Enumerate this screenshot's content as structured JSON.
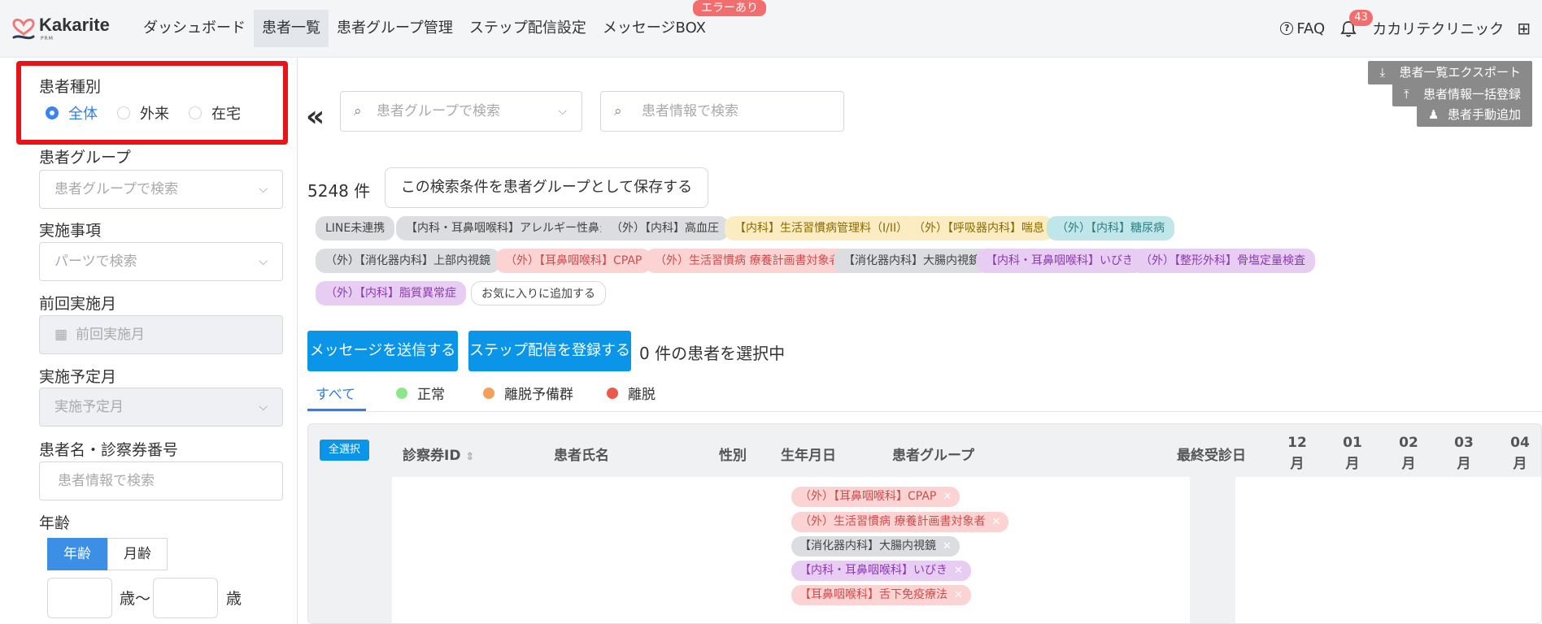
{
  "header": {
    "logo_name": "Kakarite",
    "logo_sub": "PRM",
    "nav": [
      "ダッシュボード",
      "患者一覧",
      "患者グループ管理",
      "ステップ配信設定",
      "メッセージBOX"
    ],
    "error_badge": "エラーあり",
    "faq": "FAQ",
    "notification_count": "43",
    "clinic_name": "カカリテクリニック"
  },
  "sidebar": {
    "patient_type_label": "患者種別",
    "patient_type_options": [
      "全体",
      "外来",
      "在宅"
    ],
    "patient_group_label": "患者グループ",
    "patient_group_placeholder": "患者グループで検索",
    "item_label": "実施事項",
    "item_placeholder": "パーツで検索",
    "last_month_label": "前回実施月",
    "last_month_placeholder": "前回実施月",
    "planned_month_label": "実施予定月",
    "planned_month_placeholder": "実施予定月",
    "name_label": "患者名・診察券番号",
    "name_placeholder": "患者情報で検索",
    "age_label": "年齢",
    "age_toggle": [
      "年齢",
      "月齢"
    ],
    "age_unit_from": "歳〜",
    "age_unit_to": "歳"
  },
  "main": {
    "group_search_placeholder": "患者グループで検索",
    "info_search_placeholder": "患者情報で検索",
    "export_btn": "患者一覧エクスポート",
    "bulk_btn": "患者情報一括登録",
    "manual_btn": "患者手動追加",
    "count": "5248 件",
    "save_btn": "この検索条件を患者グループとして保存する",
    "tags": [
      "LINE未連携",
      "【内科・耳鼻咽喉科】アレルギー性鼻炎",
      "（外）【内科】高血圧",
      "【内科】生活習慣病管理料（I/II）",
      "（外）【呼吸器内科】喘息",
      "（外）【内科】糖尿病",
      "（外）【消化器内科】上部内視鏡",
      "（外）【耳鼻咽喉科】CPAP",
      "（外）生活習慣病 療養計画書対象者",
      "【消化器内科】大腸内視鏡",
      "【内科・耳鼻咽喉科】いびき",
      "（外）【整形外科】骨塩定量検査",
      "（外）【内科】脂質異常症",
      "お気に入りに追加する"
    ],
    "send_message_btn": "メッセージを送信する",
    "step_btn": "ステップ配信を登録する",
    "selected_text": "0 件の患者を選択中",
    "tabs": [
      "すべて",
      "正常",
      "離脱予備群",
      "離脱"
    ],
    "table": {
      "select_all": "全選択",
      "headers": [
        "診察券ID",
        "患者氏名",
        "性別",
        "生年月日",
        "患者グループ",
        "最終受診日"
      ],
      "months": [
        "12",
        "01",
        "02",
        "03",
        "04"
      ],
      "month_suffix": "月",
      "row_tags": [
        "（外）【耳鼻咽喉科】CPAP",
        "（外）生活習慣病 療養計画書対象者",
        "【消化器内科】大腸内視鏡",
        "【内科・耳鼻咽喉科】いびき",
        "【耳鼻咽喉科】舌下免疫療法"
      ]
    }
  },
  "colors": {
    "accent": "#0b95e8",
    "highlight": "#e8141a"
  }
}
